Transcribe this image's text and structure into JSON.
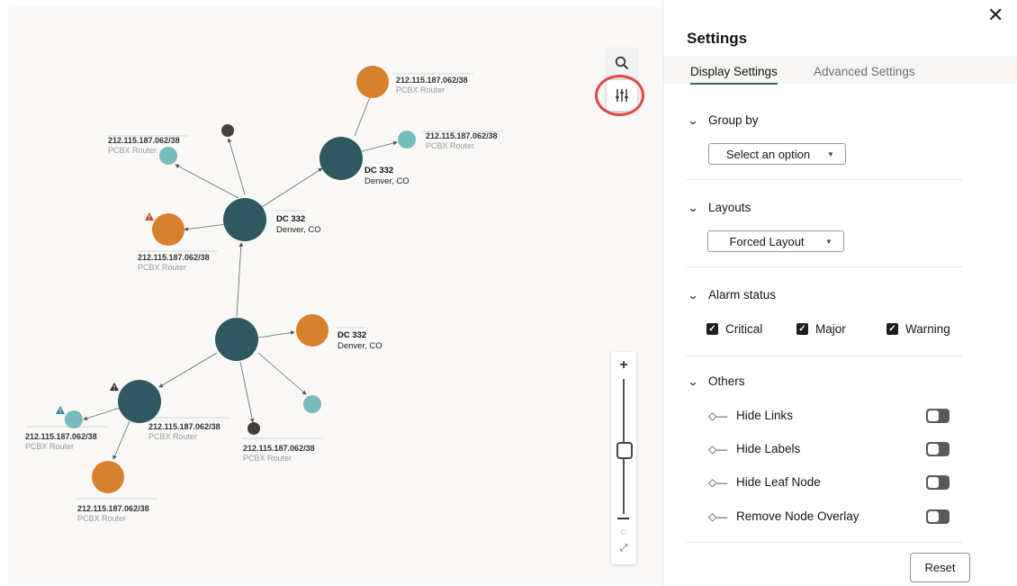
{
  "graph": {
    "router_ip": "212.115.187.062/38",
    "router_type": "PCBX Router",
    "dc_name": "DC 332",
    "dc_location": "Denver, CO",
    "warning_glyph": "!"
  },
  "toolbar": {
    "search_icon": "search-icon",
    "settings_icon": "sliders-icon"
  },
  "zoom": {
    "plus": "+",
    "fit": "◌",
    "expand": "⤢",
    "level": 0.53
  },
  "settings": {
    "close": "✕",
    "title": "Settings",
    "tabs": [
      {
        "label": "Display Settings",
        "selected": true
      },
      {
        "label": "Advanced Settings",
        "selected": false
      }
    ],
    "group_by": {
      "heading": "Group by",
      "select_value": "Select an option"
    },
    "layouts": {
      "heading": "Layouts",
      "select_value": "Forced Layout"
    },
    "alarm_status": {
      "heading": "Alarm status",
      "options": [
        {
          "label": "Critical",
          "checked": true
        },
        {
          "label": "Major",
          "checked": true
        },
        {
          "label": "Warning",
          "checked": true
        }
      ]
    },
    "others": {
      "heading": "Others",
      "items": [
        {
          "label": "Hide Links",
          "on": false
        },
        {
          "label": "Hide Labels",
          "on": false
        },
        {
          "label": "Hide Leaf Node",
          "on": false
        },
        {
          "label": "Remove Node Overlay",
          "on": false
        }
      ]
    },
    "reset_label": "Reset"
  },
  "colors": {
    "dc_node": "#2f5860",
    "router_orange": "#d6812d",
    "router_teal": "#78bdbc",
    "dark_node": "#4b3e37",
    "critical_badge": "#d2402f",
    "major_badge": "#2d2d2d",
    "warning_badge": "#3582a8",
    "accent": "#3a6b54"
  }
}
